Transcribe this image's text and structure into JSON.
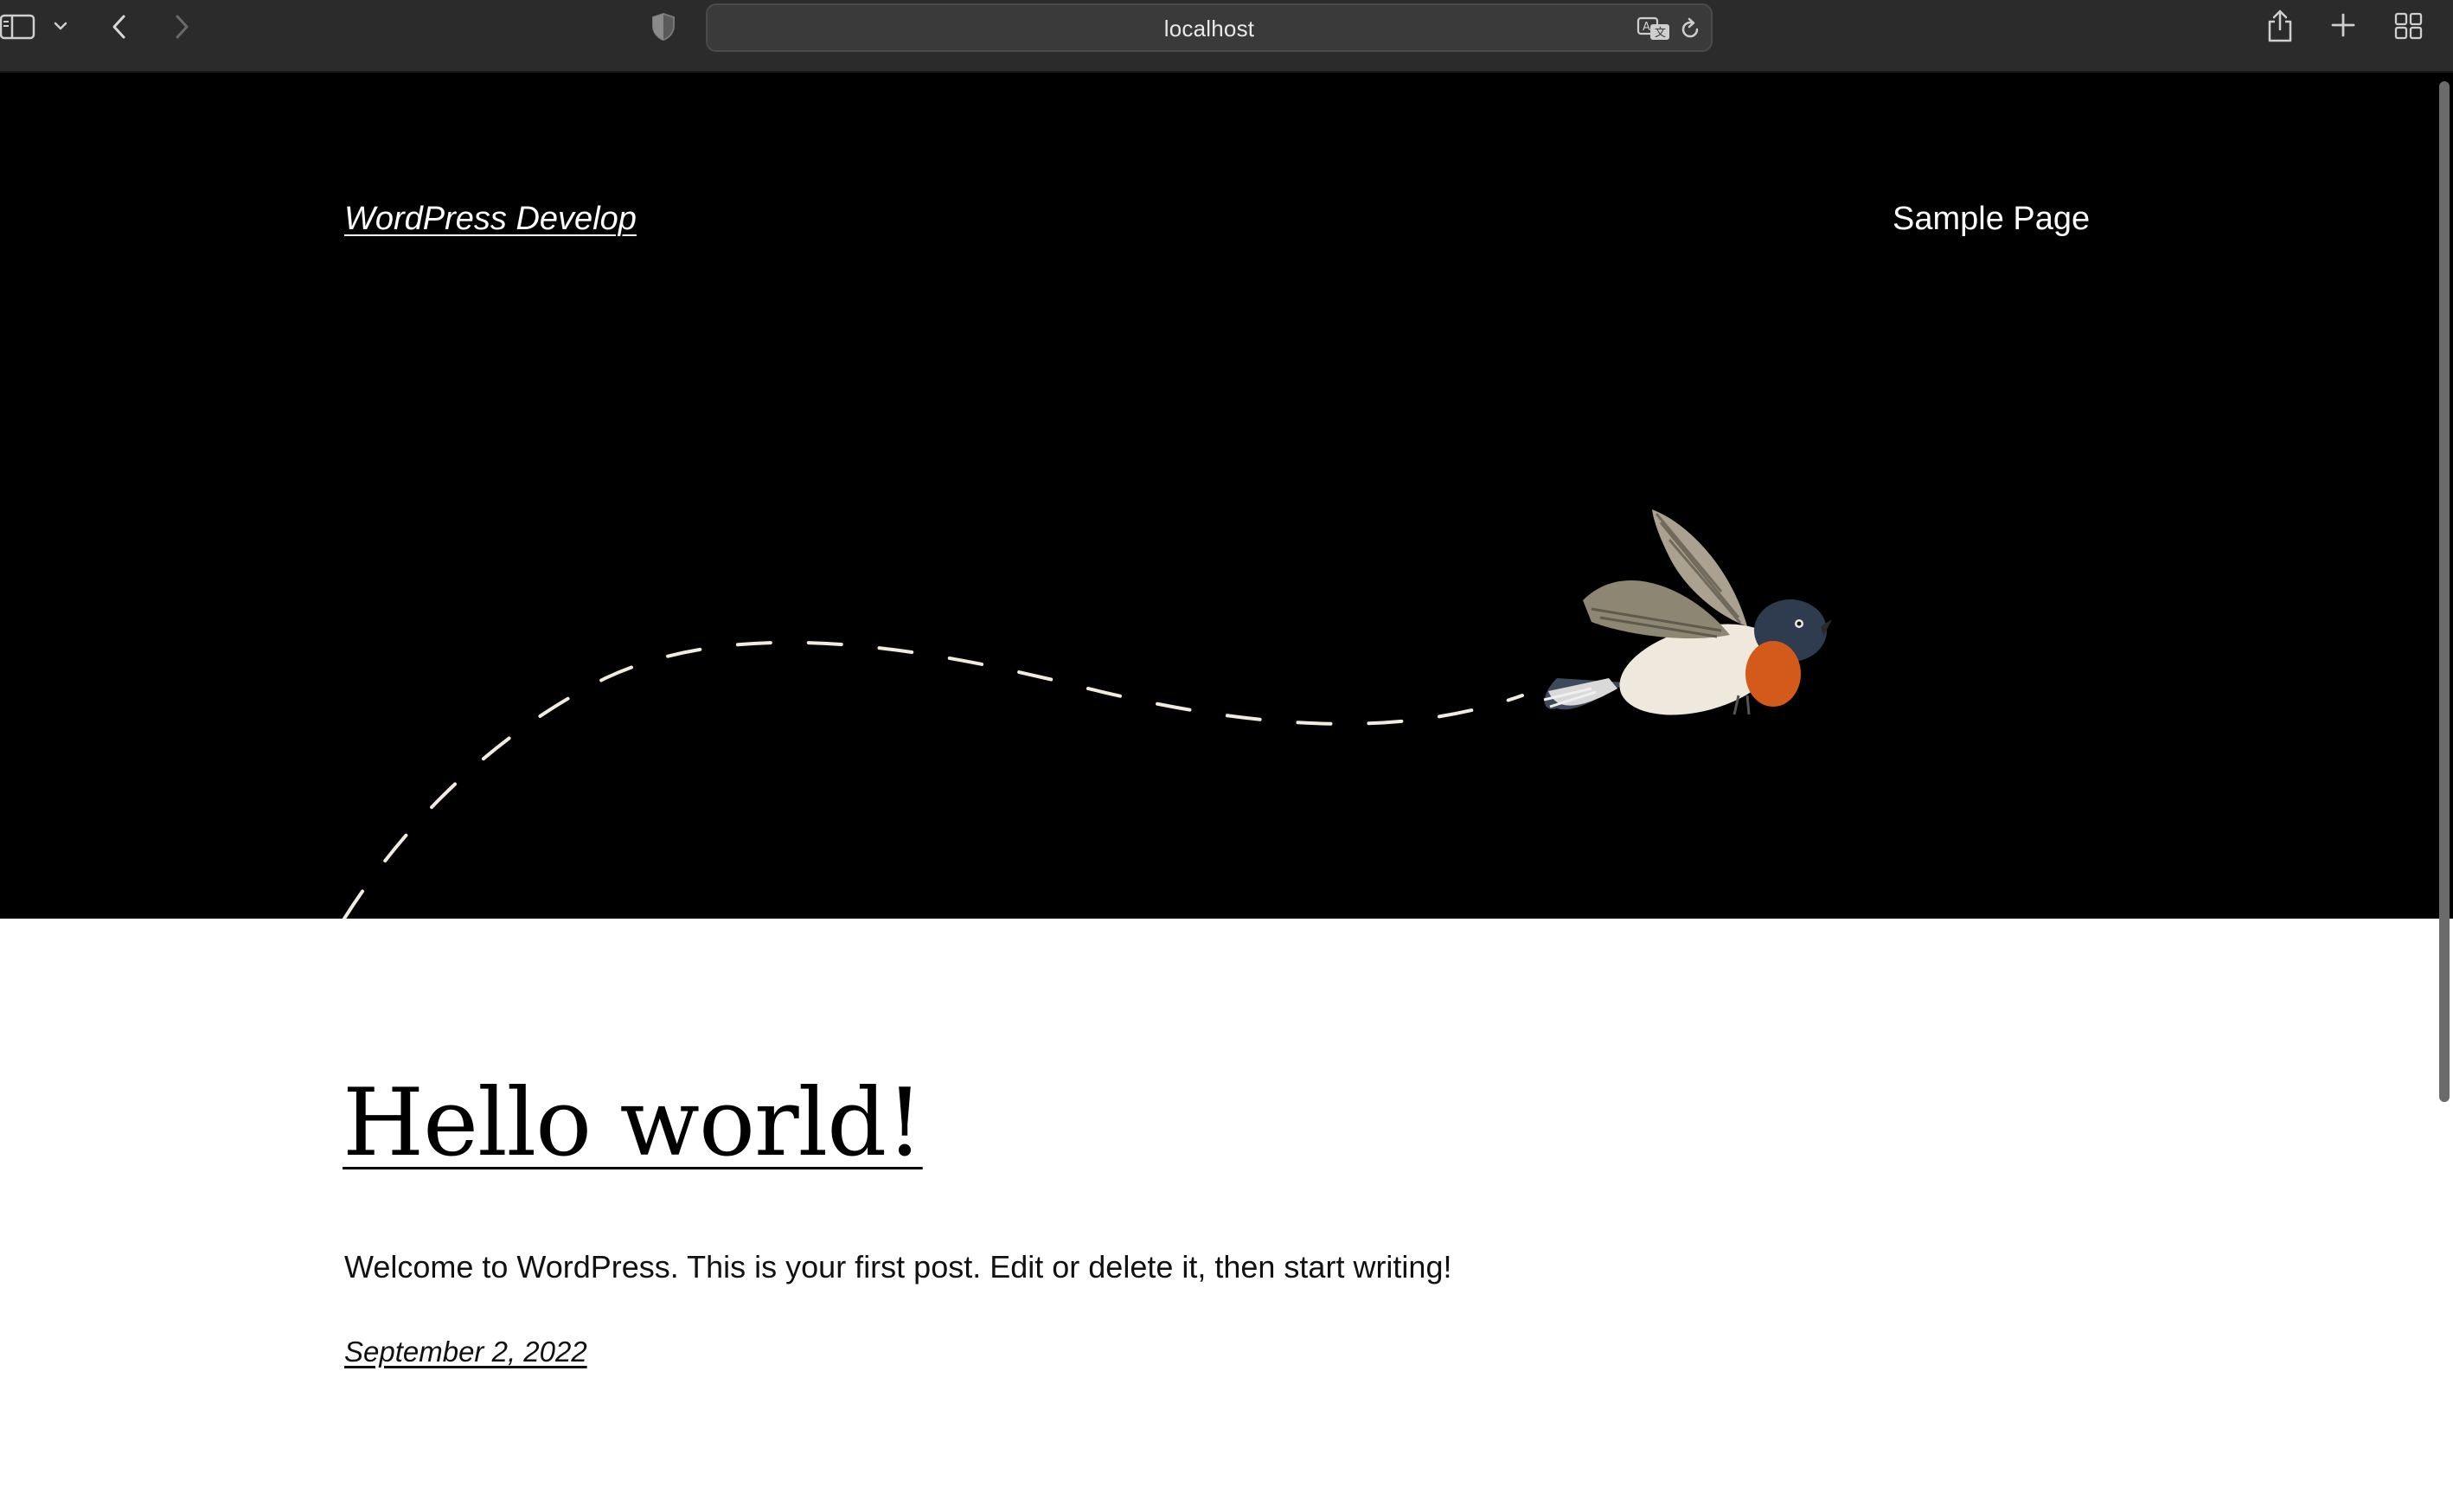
{
  "browser": {
    "url": "localhost",
    "icons": {
      "sidebar": "sidebar-icon",
      "tab_overview_dropdown": "chevron-down-icon",
      "back": "chevron-left-icon",
      "forward": "chevron-right-icon",
      "privacy": "shield-icon",
      "translate": "translate-icon",
      "reload": "reload-icon",
      "share": "share-icon",
      "new_tab": "plus-icon",
      "tabs": "grid-icon"
    }
  },
  "site": {
    "title": "WordPress Develop",
    "nav": [
      "Sample Page"
    ]
  },
  "post": {
    "title": "Hello world!",
    "excerpt": "Welcome to WordPress. This is your first post. Edit or delete it, then start writing!",
    "date": "September 2, 2022"
  },
  "colors": {
    "hero_bg": "#000000",
    "chrome_bg": "#2b2b2b",
    "bird_breast": "#d45a1c"
  }
}
